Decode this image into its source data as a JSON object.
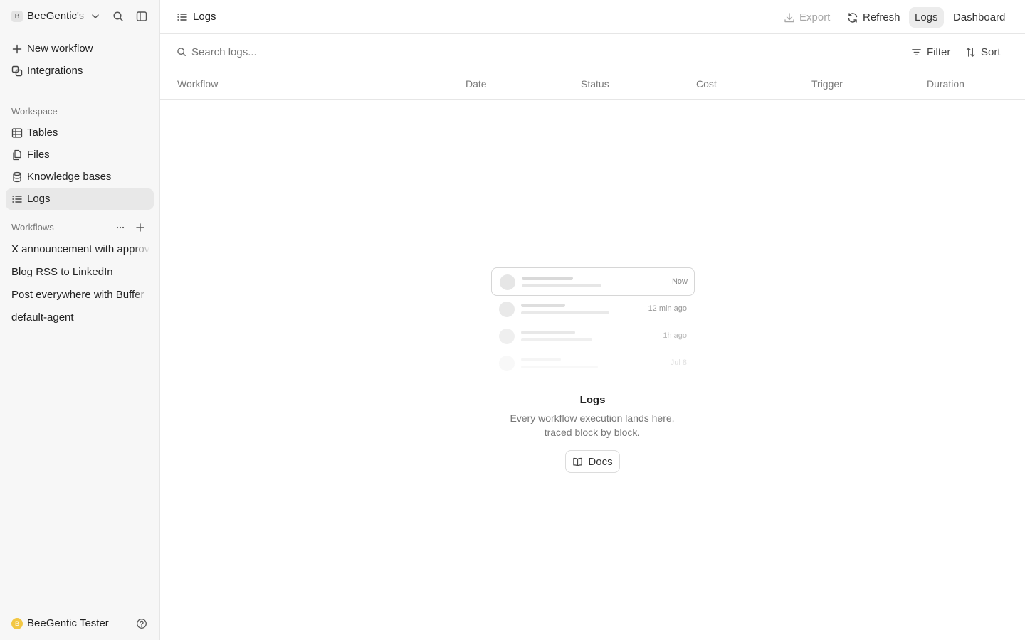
{
  "sidebar": {
    "workspace_badge": "B",
    "workspace_name": "BeeGentic's",
    "nav": {
      "new_workflow": "New workflow",
      "integrations": "Integrations"
    },
    "workspace_section": "Workspace",
    "workspace_items": {
      "tables": "Tables",
      "files": "Files",
      "knowledge_bases": "Knowledge bases",
      "logs": "Logs"
    },
    "workflows_section": "Workflows",
    "workflows": [
      "X announcement with approval",
      "Blog RSS to LinkedIn",
      "Post everywhere with Buffer",
      "default-agent"
    ],
    "user": {
      "avatar_letter": "B",
      "name": "BeeGentic Tester",
      "avatar_color": "#f2c744"
    }
  },
  "topbar": {
    "title": "Logs",
    "export": "Export",
    "refresh": "Refresh",
    "logs_tab": "Logs",
    "dashboard_tab": "Dashboard"
  },
  "search": {
    "placeholder": "Search logs...",
    "value": "",
    "filter": "Filter",
    "sort": "Sort"
  },
  "table": {
    "columns": [
      "Workflow",
      "Date",
      "Status",
      "Cost",
      "Trigger",
      "Duration"
    ]
  },
  "empty_state": {
    "illustration_times": [
      "Now",
      "12 min ago",
      "1h ago",
      "Jul 8"
    ],
    "title": "Logs",
    "description": "Every workflow execution lands here, traced block by block.",
    "docs_button": "Docs"
  }
}
